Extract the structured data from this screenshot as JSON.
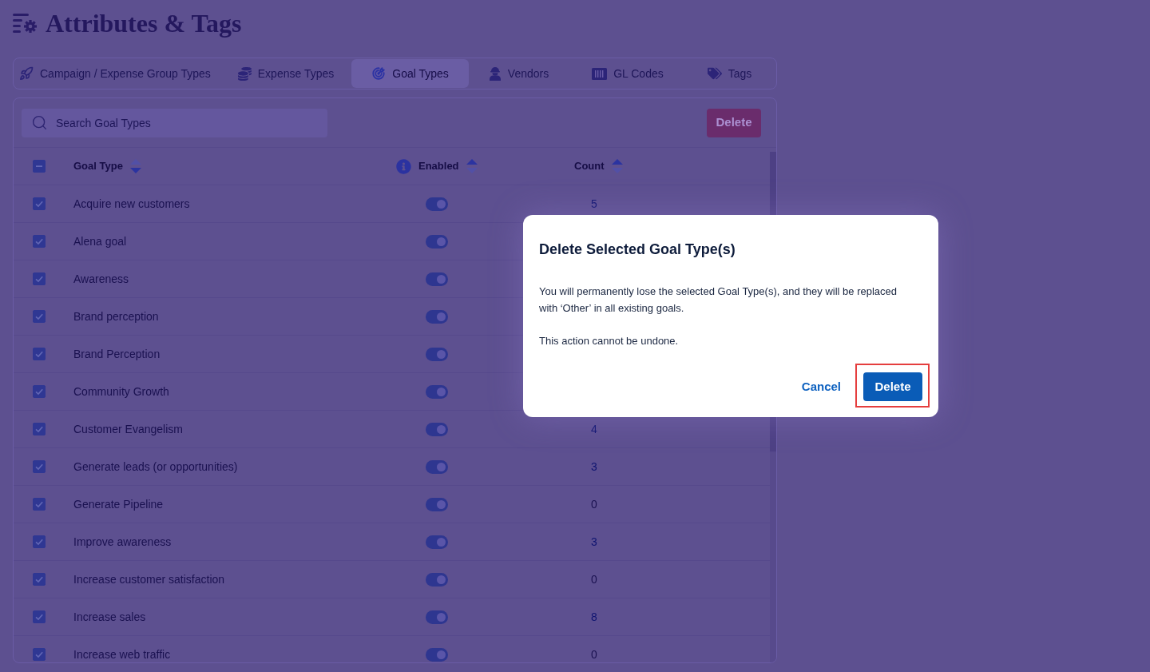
{
  "page": {
    "title": "Attributes & Tags"
  },
  "tabs": [
    {
      "label": "Campaign / Expense Group Types",
      "selected": false
    },
    {
      "label": "Expense Types",
      "selected": false
    },
    {
      "label": "Goal Types",
      "selected": true
    },
    {
      "label": "Vendors",
      "selected": false
    },
    {
      "label": "GL Codes",
      "selected": false
    },
    {
      "label": "Tags",
      "selected": false
    }
  ],
  "search": {
    "placeholder": "Search Goal Types"
  },
  "delete_button": {
    "label": "Delete"
  },
  "table": {
    "select_all": {
      "indeterminate": true
    },
    "columns": [
      {
        "label": "Goal Type",
        "sorted_down": true
      },
      {
        "label": "Enabled",
        "sorted_down": false,
        "info": true
      },
      {
        "label": "Count",
        "sorted_down": false
      }
    ],
    "rows": [
      {
        "checked": true,
        "name": "Acquire new customers",
        "enabled": true,
        "count": "5",
        "linked": true
      },
      {
        "checked": true,
        "name": "Alena goal",
        "enabled": true
      },
      {
        "checked": true,
        "name": "Awareness",
        "enabled": true
      },
      {
        "checked": true,
        "name": "Brand perception",
        "enabled": true
      },
      {
        "checked": true,
        "name": "Brand Perception",
        "enabled": true
      },
      {
        "checked": true,
        "name": "Community Growth",
        "enabled": true
      },
      {
        "checked": true,
        "name": "Customer Evangelism",
        "enabled": true,
        "count": "4",
        "linked": true
      },
      {
        "checked": true,
        "name": "Generate leads (or opportunities)",
        "enabled": true,
        "count": "3",
        "linked": true
      },
      {
        "checked": true,
        "name": "Generate Pipeline",
        "enabled": true,
        "count": "0",
        "linked": false
      },
      {
        "checked": true,
        "name": "Improve awareness",
        "enabled": true,
        "count": "3",
        "linked": true
      },
      {
        "checked": true,
        "name": "Increase customer satisfaction",
        "enabled": true,
        "count": "0",
        "linked": false
      },
      {
        "checked": true,
        "name": "Increase sales",
        "enabled": true,
        "count": "8",
        "linked": true
      },
      {
        "checked": true,
        "name": "Increase web traffic",
        "enabled": true,
        "count": "0",
        "linked": false
      }
    ]
  },
  "dialog": {
    "title": "Delete Selected Goal Type(s)",
    "body": [
      "You will permanently lose the selected Goal Type(s), and they will be replaced with ‘Other’ in all existing goals.",
      "This action cannot be undone."
    ],
    "buttons": [
      {
        "label": "Cancel",
        "kind": "link",
        "highlighted": false
      },
      {
        "label": "Delete",
        "kind": "primary",
        "highlighted": true
      }
    ]
  }
}
